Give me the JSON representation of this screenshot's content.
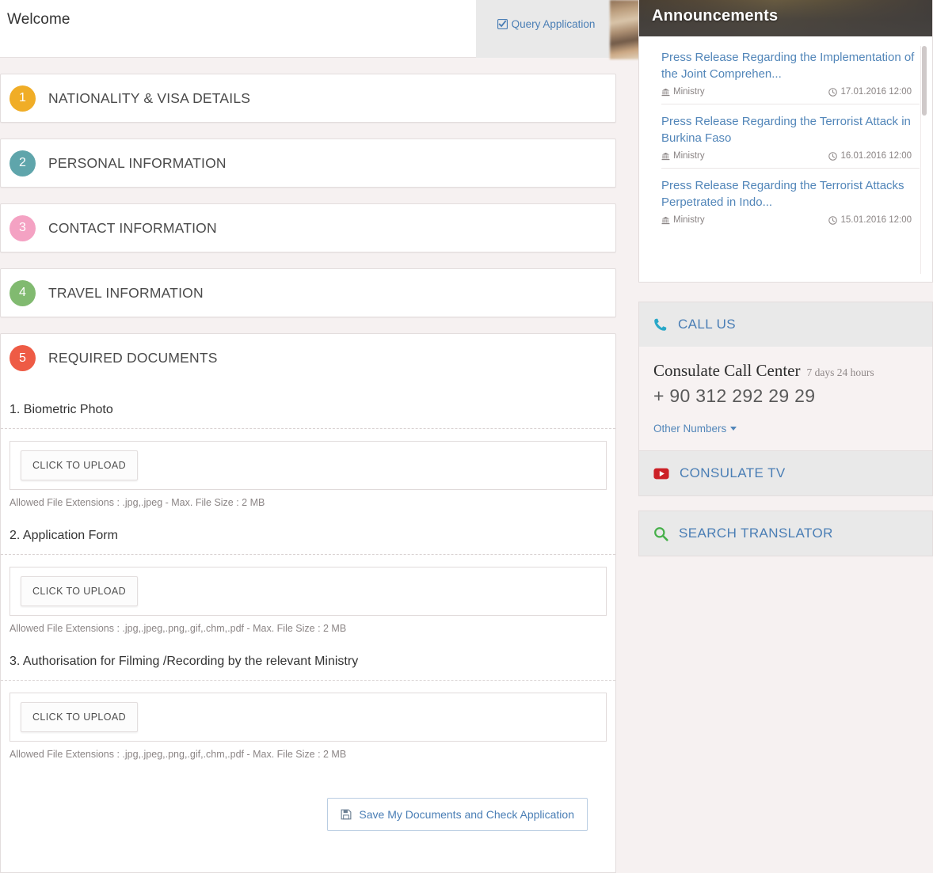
{
  "header": {
    "welcome_title": "Welcome",
    "query_tab_label": "Query Application",
    "query_tab_icon": "checkbox-checked-icon"
  },
  "steps": [
    {
      "number": "1",
      "label": "NATIONALITY & VISA DETAILS",
      "color": "#f0ad27"
    },
    {
      "number": "2",
      "label": "PERSONAL INFORMATION",
      "color": "#5fa5ab"
    },
    {
      "number": "3",
      "label": "CONTACT INFORMATION",
      "color": "#f4a2c3"
    },
    {
      "number": "4",
      "label": "TRAVEL INFORMATION",
      "color": "#81ba70"
    },
    {
      "number": "5",
      "label": "REQUIRED DOCUMENTS",
      "color": "#ee5b45"
    }
  ],
  "documents": [
    {
      "title": "1. Biometric Photo",
      "upload_label": "CLICK TO UPLOAD",
      "allowed": "Allowed File Extensions : .jpg,.jpeg - Max. File Size : 2 MB"
    },
    {
      "title": "2. Application Form",
      "upload_label": "CLICK TO UPLOAD",
      "allowed": "Allowed File Extensions : .jpg,.jpeg,.png,.gif,.chm,.pdf - Max. File Size : 2 MB"
    },
    {
      "title": "3. Authorisation for Filming /Recording by the relevant Ministry",
      "upload_label": "CLICK TO UPLOAD",
      "allowed": "Allowed File Extensions : .jpg,.jpeg,.png,.gif,.chm,.pdf - Max. File Size : 2 MB"
    }
  ],
  "save_button": {
    "label": "Save My Documents and Check Application",
    "icon": "floppy-save-icon"
  },
  "sidebar": {
    "announcements": {
      "header_title": "Announcements",
      "items": [
        {
          "title": "Press Release Regarding the Implementation of the Joint Comprehen...",
          "source": "Ministry",
          "source_icon": "bank-institution-icon",
          "date": "17.01.2016 12:00",
          "date_icon": "clock-icon"
        },
        {
          "title": "Press Release Regarding the Terrorist Attack in Burkina Faso",
          "source": "Ministry",
          "source_icon": "bank-institution-icon",
          "date": "16.01.2016 12:00",
          "date_icon": "clock-icon"
        },
        {
          "title": "Press Release Regarding the Terrorist Attacks Perpetrated in Indo...",
          "source": "Ministry",
          "source_icon": "bank-institution-icon",
          "date": "15.01.2016 12:00",
          "date_icon": "clock-icon"
        }
      ]
    },
    "call_us": {
      "header_label": "CALL US",
      "header_icon": "phone-icon",
      "center_name": "Consulate Call Center",
      "hours": "7 days 24 hours",
      "phone": "+ 90 312 292 29 29",
      "other_numbers_label": "Other Numbers"
    },
    "consulate_tv": {
      "header_label": "CONSULATE TV",
      "header_icon": "youtube-play-icon"
    },
    "search_translator": {
      "header_label": "SEARCH TRANSLATOR",
      "header_icon": "search-icon"
    }
  },
  "colors": {
    "page_background": "#f6f1f1",
    "link_blue": "#5286b9",
    "panel_header_gray": "#e9e9e9",
    "youtube_red": "#cc2127",
    "search_green": "#46b04a",
    "phone_cyan": "#29a8c8"
  }
}
